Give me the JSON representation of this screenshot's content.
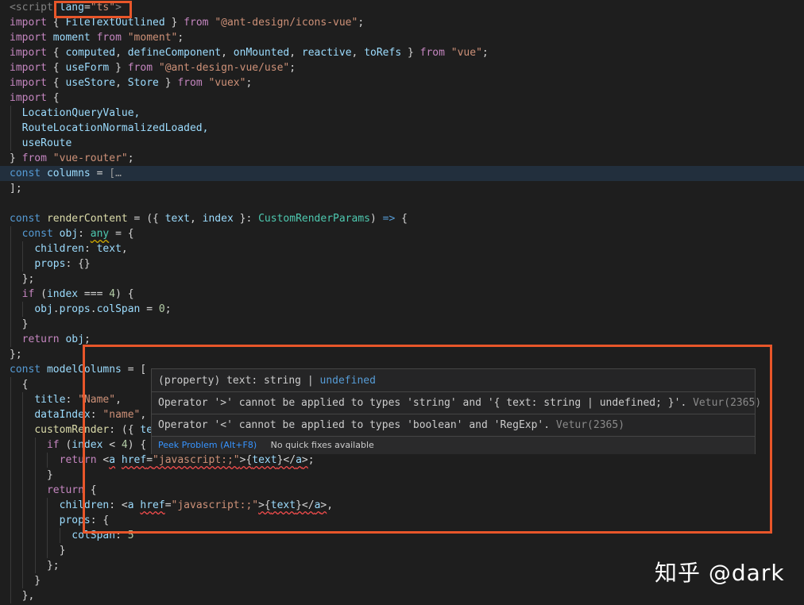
{
  "code": {
    "l1_tag": "<script ",
    "l1_attr": "lang",
    "l1_eq": "=",
    "l1_val": "\"ts\"",
    "l1_close": ">",
    "import": "import",
    "from": "from",
    "l2_names": "FileTextOutlined",
    "l2_src": "\"@ant-design/icons-vue\"",
    "l3_name": "moment",
    "l3_src": "\"moment\"",
    "l4_names": [
      "computed",
      "defineComponent",
      "onMounted",
      "reactive",
      "toRefs"
    ],
    "l4_src": "\"vue\"",
    "l5_names": "useForm",
    "l5_src": "\"@ant-design-vue/use\"",
    "l6_names": [
      "useStore",
      "Store"
    ],
    "l6_src": "\"vuex\"",
    "l8": "LocationQueryValue,",
    "l9": "RouteLocationNormalizedLoaded,",
    "l10": "useRoute",
    "l11_src": "\"vue-router\"",
    "const": "const",
    "l12_name": "columns",
    "l12_fold": "[…",
    "l15_name": "renderContent",
    "l15_p1": "text",
    "l15_p2": "index",
    "l15_type": "CustomRenderParams",
    "l16_name": "obj",
    "l16_type": "any",
    "l17": "children",
    "l17_val": "text",
    "l18": "props",
    "if": "if",
    "l20_var": "index",
    "l20_num": "4",
    "l21_a": "obj",
    "l21_b": "props",
    "l21_c": "colSpan",
    "l21_num": "0",
    "return": "return",
    "l23_val": "obj",
    "l25_name": "modelColumns",
    "l27_key": "title",
    "l27_val": "\"Name\"",
    "l28_key": "dataIndex",
    "l28_val": "\"name\"",
    "l29_key": "customRender",
    "l29_p": "te",
    "l30_var": "index",
    "l30_num": "4",
    "a_tag": "a",
    "href": "href",
    "href_val": "\"javascript:;\"",
    "text": "text",
    "l33_key": "children",
    "l34_key": "props",
    "l35_key": "colSpan",
    "l35_num": "5"
  },
  "hover": {
    "sig_prefix": "(property) text: string | ",
    "sig_undefined": "undefined",
    "msg1": "Operator '>' cannot be applied to types 'string' and '{ text: string | undefined; }'.",
    "msg1_src": "Vetur(2365)",
    "msg2": "Operator '<' cannot be applied to types 'boolean' and 'RegExp'.",
    "msg2_src": "Vetur(2365)",
    "peek": "Peek Problem (Alt+F8)",
    "no_fix": "No quick fixes available"
  },
  "watermark": "知乎 @dark",
  "colors": {
    "highlight": "#e8562a",
    "editor_bg": "#1e1e1e"
  }
}
